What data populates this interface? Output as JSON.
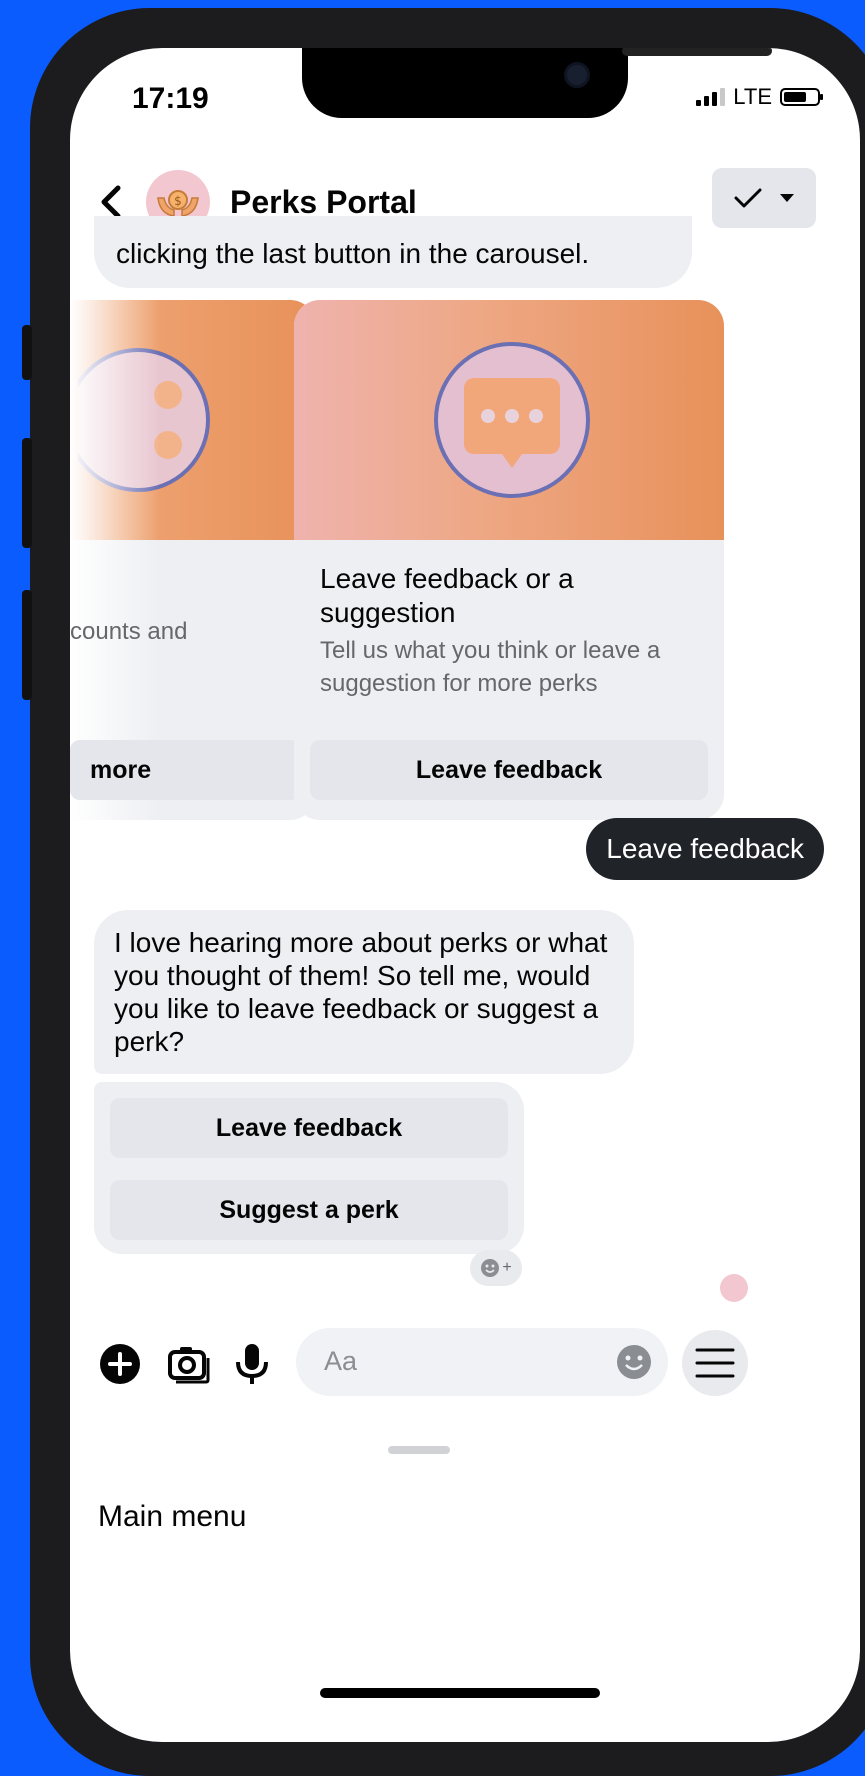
{
  "status_bar": {
    "time": "17:19",
    "network": "LTE"
  },
  "header": {
    "title": "Perks Portal"
  },
  "messages": {
    "truncated_text": "clicking the last button in the carousel.",
    "carousel": [
      {
        "desc": "counts and",
        "button": "more"
      },
      {
        "title": "Leave feedback or a suggestion",
        "desc": "Tell us what you think or leave a suggestion for more perks",
        "button": "Leave feedback"
      }
    ],
    "user_reply": "Leave feedback",
    "bot_message": "I love hearing more about perks or what you thought of them! So tell me, would you like to leave feedback or suggest a perk?",
    "quick_replies": [
      "Leave feedback",
      "Suggest a perk"
    ]
  },
  "composer": {
    "placeholder": "Aa"
  },
  "footer": {
    "label": "Main menu"
  },
  "colors": {
    "background": "#0a5cff",
    "outgoing_bubble": "#202328",
    "card_gradient": "#e8915a"
  }
}
